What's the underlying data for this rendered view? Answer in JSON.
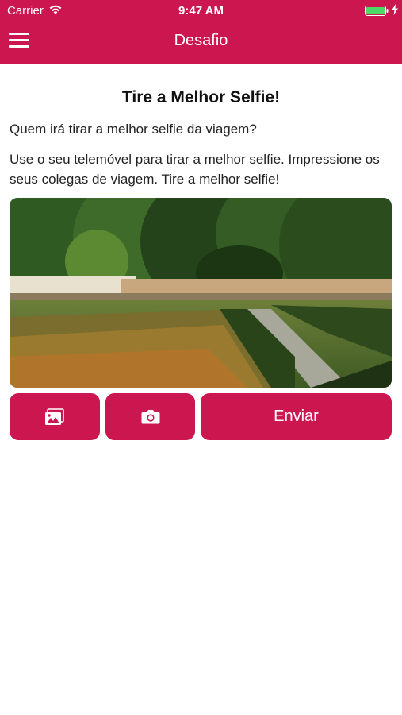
{
  "status_bar": {
    "carrier": "Carrier",
    "time": "9:47 AM",
    "wifi_icon": "wifi-icon",
    "battery_icon": "battery-icon",
    "charging_icon": "bolt-icon"
  },
  "nav": {
    "title": "Desafio",
    "menu_icon": "hamburger-menu-icon"
  },
  "challenge": {
    "title": "Tire a Melhor Selfie!",
    "question": "Quem irá tirar a melhor selfie da viagem?",
    "description": "Use o seu telemóvel para tirar a melhor selfie. Impressione os seus colegas de viagem. Tire a melhor selfie!"
  },
  "actions": {
    "gallery_icon": "image-gallery-icon",
    "camera_icon": "camera-icon",
    "send_label": "Enviar"
  },
  "colors": {
    "brand": "#cc1650",
    "background": "#ffffff",
    "text": "#111111"
  }
}
